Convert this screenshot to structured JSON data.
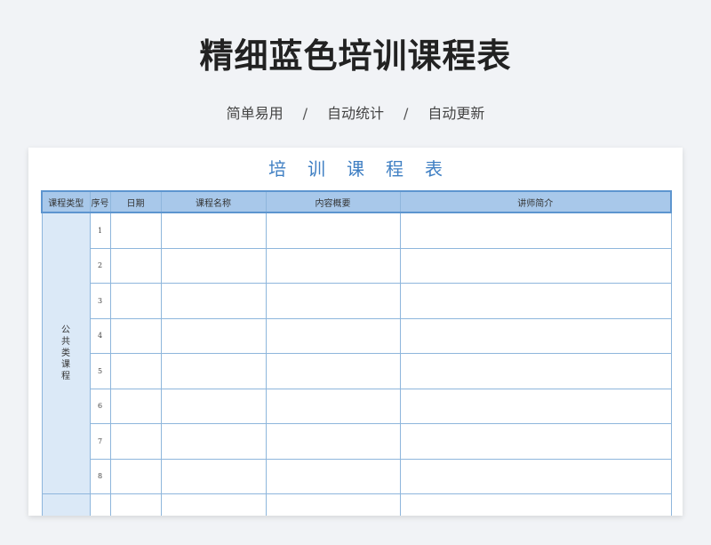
{
  "header": {
    "title": "精细蓝色培训课程表",
    "tags": [
      "简单易用",
      "自动统计",
      "自动更新"
    ],
    "separator": "/"
  },
  "sheet": {
    "title": "培训课程表",
    "columns": [
      "课程类型",
      "序号",
      "日期",
      "课程名称",
      "内容概要",
      "讲师简介"
    ],
    "category": "公共类课程",
    "rows": [
      {
        "no": "1"
      },
      {
        "no": "2"
      },
      {
        "no": "3"
      },
      {
        "no": "4"
      },
      {
        "no": "5"
      },
      {
        "no": "6"
      },
      {
        "no": "7"
      },
      {
        "no": "8"
      }
    ]
  },
  "colors": {
    "title_blue": "#3f7fc3",
    "header_fill": "#a8c8ea",
    "category_fill": "#dbe9f7",
    "grid_line": "#8eb6dc"
  }
}
